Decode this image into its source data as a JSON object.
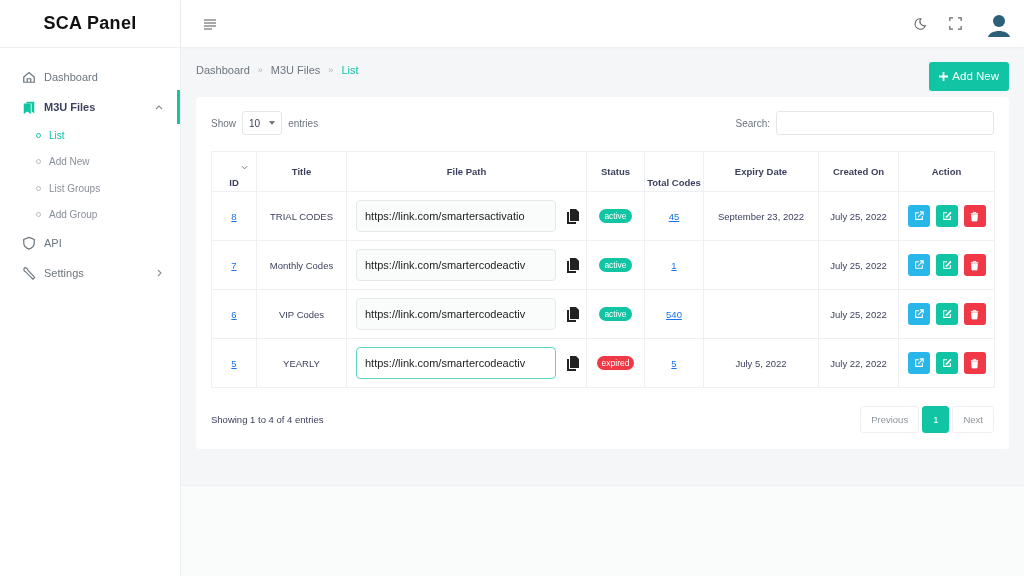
{
  "brand": "SCA Panel",
  "nav": [
    {
      "label": "Dashboard",
      "kind": "home",
      "selected": false
    },
    {
      "label": "M3U Files",
      "kind": "bookmark",
      "selected": true,
      "expanded": true,
      "children": [
        {
          "label": "List",
          "selected": true
        },
        {
          "label": "Add New",
          "selected": false
        },
        {
          "label": "List Groups",
          "selected": false
        },
        {
          "label": "Add Group",
          "selected": false
        }
      ]
    },
    {
      "label": "API",
      "kind": "shield",
      "selected": false
    },
    {
      "label": "Settings",
      "kind": "wrench",
      "selected": false,
      "expanded": false
    }
  ],
  "breadcrumb": [
    {
      "label": "Dashboard",
      "selected": false
    },
    {
      "label": "M3U Files",
      "selected": false
    },
    {
      "label": "List",
      "selected": true
    }
  ],
  "breadcrumb_separator": "»",
  "add_button": "Add New",
  "length_control": {
    "before": "Show",
    "value": "10",
    "after": "entries"
  },
  "search_label": "Search:",
  "columns": [
    "ID",
    "Title",
    "File Path",
    "Status",
    "Total Codes",
    "Expiry Date",
    "Created On",
    "Action"
  ],
  "rows": [
    {
      "id": "8",
      "title": "TRIAL CODES",
      "file_path": "https://link.com/smartersactivatio",
      "focused": false,
      "status": {
        "label": "active",
        "kind": "active"
      },
      "total_codes": "45",
      "expiry_date": "September 23, 2022",
      "created_on": "July 25, 2022"
    },
    {
      "id": "7",
      "title": "Monthly Codes",
      "file_path": "https://link.com/smartercodeactiv",
      "focused": false,
      "status": {
        "label": "active",
        "kind": "active"
      },
      "total_codes": "1",
      "created_on": "July 25, 2022"
    },
    {
      "id": "6",
      "title": "VIP Codes",
      "file_path": "https://link.com/smartercodeactiv",
      "focused": false,
      "status": {
        "label": "active",
        "kind": "active"
      },
      "total_codes": "540",
      "created_on": "July 25, 2022"
    },
    {
      "id": "5",
      "title": "YEARLY",
      "file_path": "https://link.com/smartercodeactiv",
      "focused": true,
      "status": {
        "label": "expired",
        "kind": "expired"
      },
      "total_codes": "5",
      "expiry_date": "July 5, 2022",
      "created_on": "July 22, 2022"
    }
  ],
  "info": "Showing 1 to 4 of 4 entries",
  "pagination": {
    "previous": {
      "label": "Previous",
      "disabled": true
    },
    "pages": [
      {
        "label": "1",
        "selected": true
      }
    ],
    "next": {
      "label": "Next",
      "disabled": true
    }
  }
}
